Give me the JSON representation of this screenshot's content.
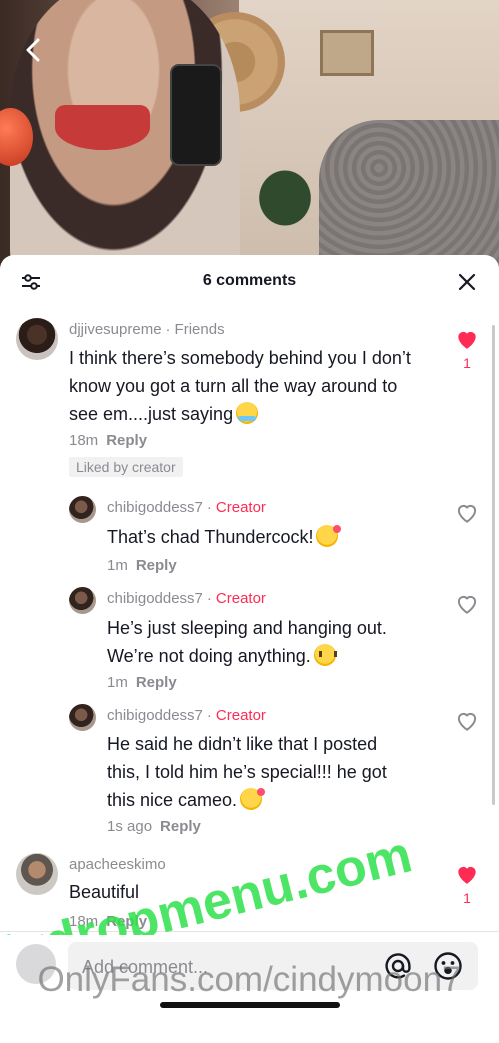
{
  "header": {
    "title": "6 comments"
  },
  "comments": [
    {
      "username": "djjivesupreme",
      "tag": "Friends",
      "text": "I think there’s somebody behind you I don’t know you got a turn all the way around to see em....just saying",
      "time": "18m",
      "reply": "Reply",
      "badge": "Liked by creator",
      "likes": "1",
      "liked": true
    },
    {
      "username": "apacheeskimo",
      "text": "Beautiful",
      "time": "18m",
      "reply": "Reply",
      "likes": "1",
      "liked": true
    }
  ],
  "replies": [
    {
      "username": "chibigoddess7",
      "tag": "Creator",
      "text": "That’s chad Thundercock!",
      "time": "1m",
      "reply": "Reply"
    },
    {
      "username": "chibigoddess7",
      "tag": "Creator",
      "text_line1": "He’s just sleeping and hanging out.",
      "text_line2": "We’re not doing anything.",
      "time": "1m",
      "reply": "Reply"
    },
    {
      "username": "chibigoddess7",
      "tag": "Creator",
      "text_line1": "He said he didn’t like that I posted",
      "text_line2": "this, I told him he’s special!!! he got",
      "text_line3": "this nice cameo.",
      "time": "1s ago",
      "reply": "Reply"
    }
  ],
  "composer": {
    "placeholder": "Add comment..."
  },
  "watermarks": {
    "wm1": "Hydropmenu.com",
    "wm2": "OnlyFans.com/cindymoon7"
  },
  "colors": {
    "accent": "#fe2c55",
    "text": "#161823",
    "muted": "#8a8b91"
  }
}
